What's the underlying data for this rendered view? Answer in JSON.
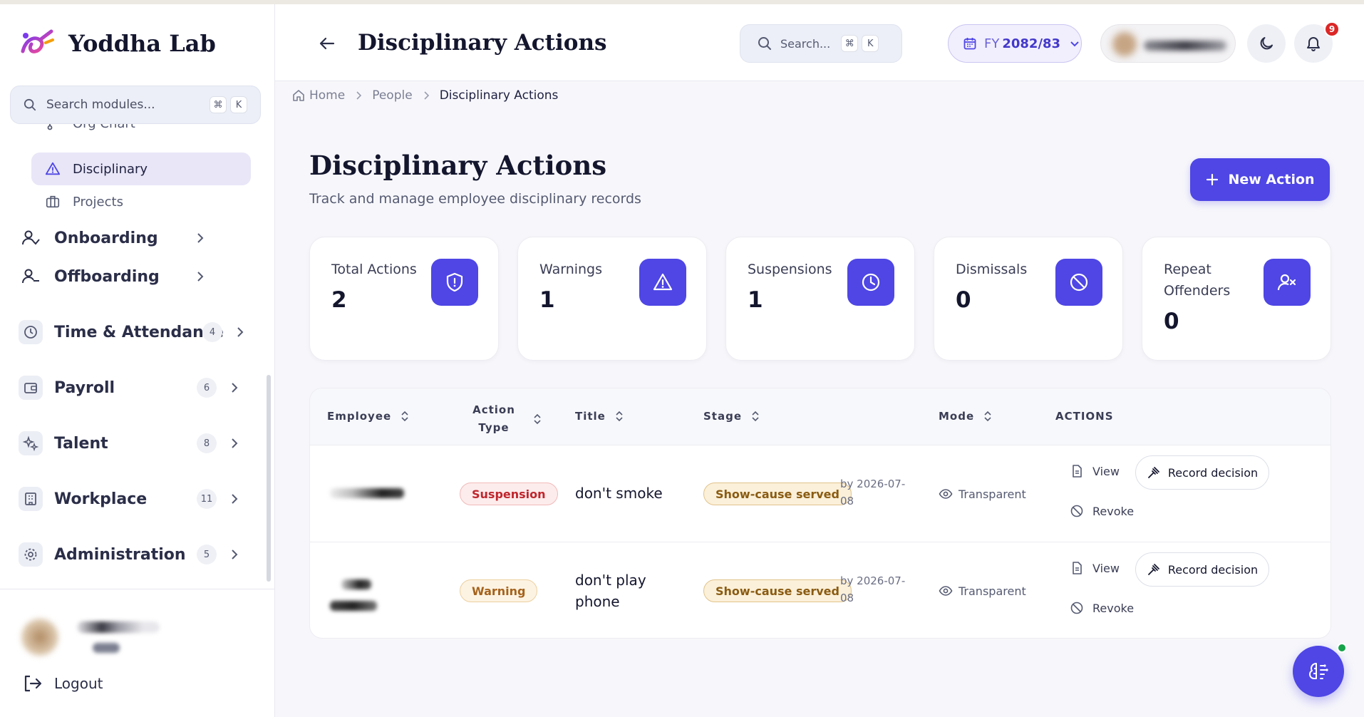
{
  "app": {
    "name": "Yoddha Lab",
    "accent": "#4f46e5"
  },
  "sidebar": {
    "search": {
      "placeholder": "Search modules...",
      "shortcut_cmd": "⌘",
      "shortcut_key": "K"
    },
    "sub_items": [
      {
        "label": "Org Chart",
        "icon": "org-chart-icon"
      },
      {
        "label": "Disciplinary",
        "icon": "warning-triangle-icon",
        "active": true
      },
      {
        "label": "Projects",
        "icon": "briefcase-icon"
      }
    ],
    "items": [
      {
        "label": "Onboarding",
        "icon": "user-check-icon"
      },
      {
        "label": "Offboarding",
        "icon": "user-minus-icon"
      },
      {
        "label": "Time & Attendance",
        "icon": "clock-icon",
        "count": "4"
      },
      {
        "label": "Payroll",
        "icon": "wallet-icon",
        "count": "6"
      },
      {
        "label": "Talent",
        "icon": "sparkles-icon",
        "count": "8"
      },
      {
        "label": "Workplace",
        "icon": "building-icon",
        "count": "11"
      },
      {
        "label": "Administration",
        "icon": "gear-icon",
        "count": "5"
      }
    ],
    "logout_label": "Logout"
  },
  "header": {
    "title": "Disciplinary Actions",
    "search": {
      "placeholder": "Search...",
      "shortcut_cmd": "⌘",
      "shortcut_key": "K"
    },
    "fiscal_year": {
      "label": "FY",
      "value": "2082/83"
    },
    "notifications_count": "9"
  },
  "breadcrumb": [
    "Home",
    "People",
    "Disciplinary Actions"
  ],
  "page": {
    "title": "Disciplinary Actions",
    "subtitle": "Track and manage employee disciplinary records",
    "new_button": "New Action"
  },
  "stats": [
    {
      "label": "Total Actions",
      "value": "2",
      "icon": "shield-alert-icon"
    },
    {
      "label": "Warnings",
      "value": "1",
      "icon": "warning-triangle-icon"
    },
    {
      "label": "Suspensions",
      "value": "1",
      "icon": "clock-icon"
    },
    {
      "label": "Dismissals",
      "value": "0",
      "icon": "ban-icon"
    },
    {
      "label": "Repeat Offenders",
      "value": "0",
      "icon": "user-x-icon"
    }
  ],
  "table": {
    "columns": [
      "Employee",
      "Action Type",
      "Title",
      "Stage",
      "Mode",
      "ACTIONS"
    ],
    "rows": [
      {
        "action_type": "Suspension",
        "title": "don't smoke",
        "stage": "Show-cause served",
        "due": "by 2026-07-08",
        "mode": "Transparent",
        "view": "View",
        "record": "Record decision",
        "revoke": "Revoke"
      },
      {
        "action_type": "Warning",
        "title": "don't play phone",
        "stage": "Show-cause served",
        "due": "by 2026-07-08",
        "mode": "Transparent",
        "view": "View",
        "record": "Record decision",
        "revoke": "Revoke"
      }
    ]
  }
}
